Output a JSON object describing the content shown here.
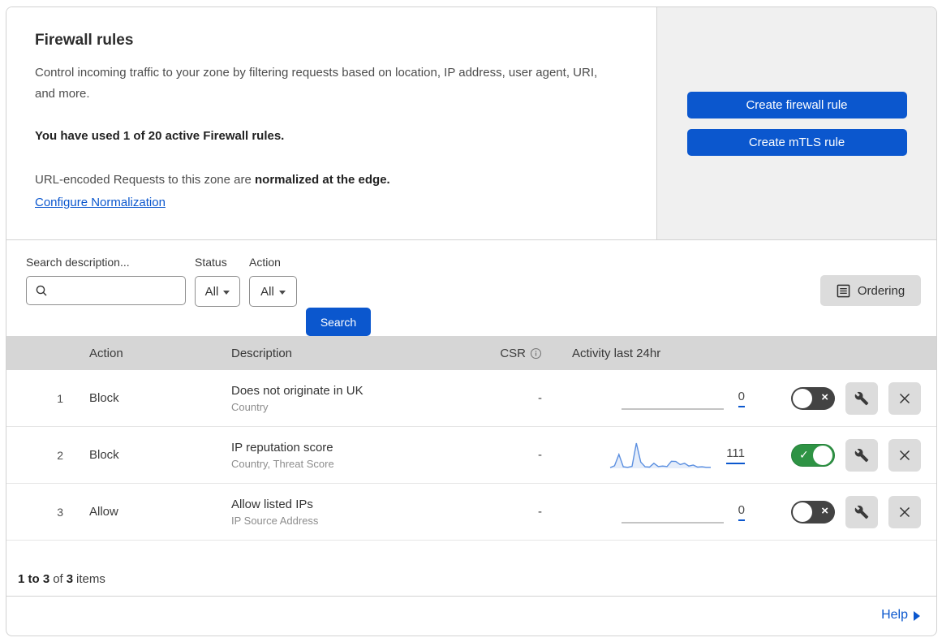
{
  "intro": {
    "title": "Firewall rules",
    "description": "Control incoming traffic to your zone by filtering requests based on location, IP address, user agent, URI, and more.",
    "usage": "You have used 1 of 20 active Firewall rules.",
    "normalization_prefix": "URL-encoded Requests to this zone are ",
    "normalization_bold": "normalized at the edge.",
    "normalization_link": "Configure Normalization",
    "create_firewall_button": "Create firewall rule",
    "create_mtls_button": "Create mTLS rule"
  },
  "filters": {
    "search_label": "Search description...",
    "search_value": "",
    "status_label": "Status",
    "status_value": "All",
    "action_label": "Action",
    "action_value": "All",
    "search_button": "Search",
    "ordering_button": "Ordering"
  },
  "table": {
    "headers": {
      "action": "Action",
      "description": "Description",
      "csr": "CSR",
      "activity": "Activity last 24hr"
    },
    "rows": [
      {
        "num": "1",
        "action": "Block",
        "description": "Does not originate in UK",
        "fields": "Country",
        "csr": "-",
        "activity_count": "0",
        "enabled": false,
        "has_sparkline": false
      },
      {
        "num": "2",
        "action": "Block",
        "description": "IP reputation score",
        "fields": "Country, Threat Score",
        "csr": "-",
        "activity_count": "111",
        "enabled": true,
        "has_sparkline": true
      },
      {
        "num": "3",
        "action": "Allow",
        "description": "Allow listed IPs",
        "fields": "IP Source Address",
        "csr": "-",
        "activity_count": "0",
        "enabled": false,
        "has_sparkline": false
      }
    ],
    "footer": {
      "range": "1 to 3",
      "of": "of",
      "total": "3",
      "items": "items"
    }
  },
  "sparkline": {
    "row_index": 1,
    "values": [
      3,
      10,
      55,
      6,
      4,
      8,
      100,
      25,
      6,
      5,
      20,
      7,
      9,
      7,
      28,
      27,
      15,
      20,
      9,
      13,
      5,
      6,
      4,
      4
    ],
    "line_color": "#5b8fe0",
    "fill_color": "rgba(110,155,230,0.18)"
  },
  "help": {
    "label": "Help"
  },
  "colors": {
    "accent_blue": "#0b57ce",
    "link_blue": "#0b57ce",
    "toggle_on_green": "#2e9344",
    "toggle_off_dark": "#434343",
    "panel_gray": "#f0f0f0",
    "table_header_gray": "#d6d6d6",
    "gray_button": "#dcdcdc"
  }
}
